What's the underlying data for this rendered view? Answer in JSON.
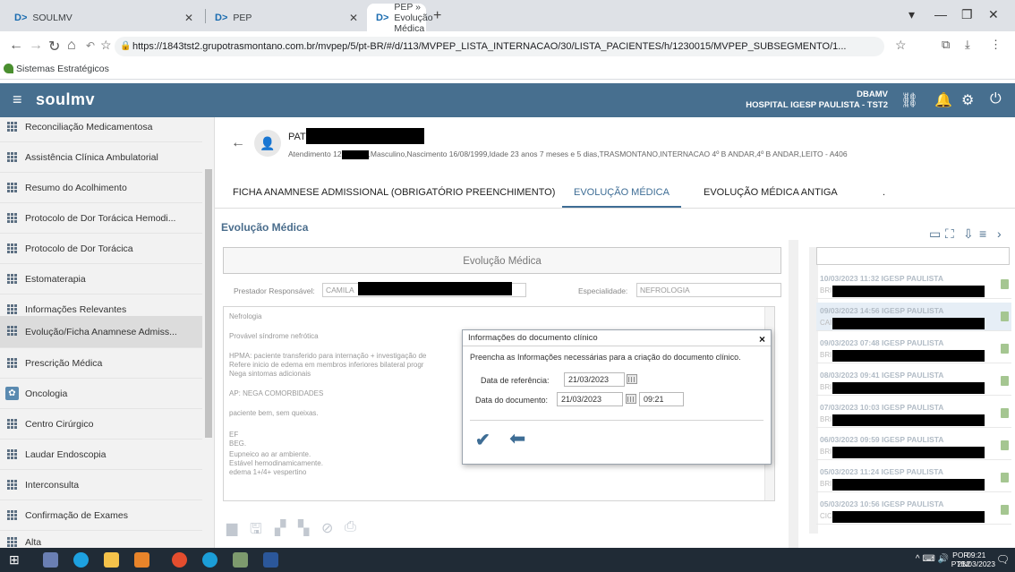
{
  "browser": {
    "tabs": [
      {
        "logo": "D>",
        "title": "SOULMV"
      },
      {
        "logo": "D>",
        "title": "PEP"
      },
      {
        "logo": "D>",
        "title": "PEP » Evolução Médica"
      }
    ],
    "url": "https://1843tst2.grupotrasmontano.com.br/mvpep/5/pt-BR/#/d/113/MVPEP_LISTA_INTERNACAO/30/LISTA_PACIENTES/h/1230015/MVPEP_SUBSEGMENTO/1...",
    "bookmark": "Sistemas Estratégicos"
  },
  "header": {
    "brand": "soulmv",
    "user": "DBAMV",
    "hospital": "HOSPITAL IGESP PAULISTA - TST2"
  },
  "sidebar": {
    "items": [
      "Reconciliação Medicamentosa",
      "Assistência Clínica Ambulatorial",
      "Resumo do Acolhimento",
      "Protocolo de Dor Torácica Hemodi...",
      "Protocolo de Dor Torácica",
      "Estomaterapia",
      "Informações Relevantes",
      "Evolução/Ficha Anamnese Admiss...",
      "Prescrição Médica",
      "Oncologia",
      "Centro Cirúrgico",
      "Laudar Endoscopia",
      "Interconsulta",
      "Confirmação de Exames",
      "Alta"
    ]
  },
  "patient": {
    "name": "PAT",
    "info_prefix": "Atendimento 12",
    "info_suffix": ",Masculino,Nascimento 16/08/1999,Idade 23 anos 7 meses e 5 dias,TRASMONTANO,INTERNACAO 4º B ANDAR,4º B ANDAR,LEITO - A406"
  },
  "tabs": [
    {
      "label": "FICHA ANAMNESE ADMISSIONAL (OBRIGATÓRIO PREENCHIMENTO)"
    },
    {
      "label": "EVOLUÇÃO MÉDICA"
    },
    {
      "label": "EVOLUÇÃO MÉDICA ANTIGA"
    },
    {
      "label": "."
    }
  ],
  "section_title": "Evolução Médica",
  "document": {
    "header": "Evolução Médica",
    "prestador_label": "Prestador Responsável:",
    "prestador_value": "CAMILA",
    "especialidade_label": "Especialidade:",
    "especialidade_value": "NEFROLOGIA",
    "lines": [
      "Nefrologia",
      "Provável síndrome nefrótica",
      "HPMA: paciente transferido para internação + investigação de",
      "Refere inicio de edema em membros inferiores bilateral progr",
      "Nega sintomas adicionais",
      "AP: NEGA COMORBIDADES",
      "paciente bem, sem queixas.",
      "EF",
      "BEG.",
      "Eupneico ao ar ambiente.",
      "Estável hemodinamicamente.",
      "edema 1+/4+ vespertino"
    ]
  },
  "history": [
    {
      "date": "10/03/2023 11:32 IGESP PAULISTA",
      "sub": "BRI"
    },
    {
      "date": "09/03/2023 14:56 IGESP PAULISTA",
      "sub": "CAI"
    },
    {
      "date": "09/03/2023 07:48 IGESP PAULISTA",
      "sub": "BRI"
    },
    {
      "date": "08/03/2023 09:41 IGESP PAULISTA",
      "sub": "BRI"
    },
    {
      "date": "07/03/2023 10:03 IGESP PAULISTA",
      "sub": "BRI"
    },
    {
      "date": "06/03/2023 09:59 IGESP PAULISTA",
      "sub": "BRI"
    },
    {
      "date": "05/03/2023 11:24 IGESP PAULISTA",
      "sub": "BRI"
    },
    {
      "date": "05/03/2023 10:56 IGESP PAULISTA",
      "sub": "CIC"
    }
  ],
  "modal": {
    "title": "Informações do documento clínico",
    "close": "×",
    "message": "Preencha as Informações necessárias para a criação do documento clínico.",
    "ref_label": "Data de referência:",
    "ref_value": "21/03/2023",
    "doc_label": "Data do documento:",
    "doc_value": "21/03/2023",
    "time_value": "09:21"
  },
  "taskbar": {
    "lang_1": "POR",
    "lang_2": "PTB2",
    "time": "09:21",
    "date": "21/03/2023"
  },
  "colors": {
    "header": "#476f8f",
    "accent": "#3e6d95",
    "taskbar": "#202b36"
  }
}
